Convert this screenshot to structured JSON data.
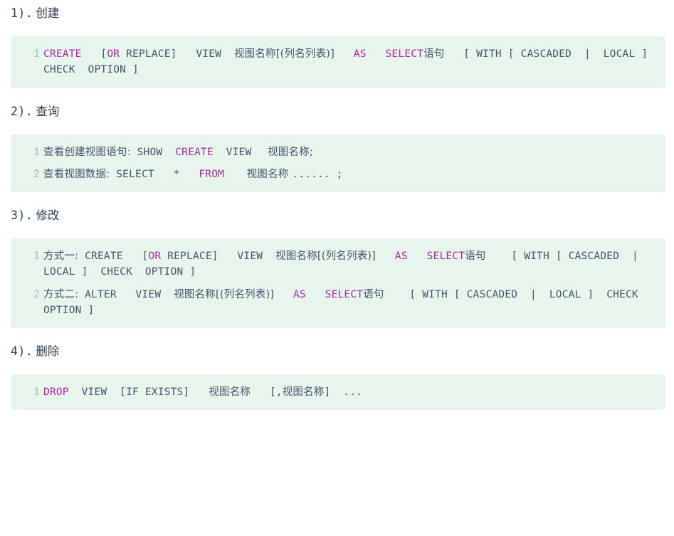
{
  "page": {
    "background": "#ffffff",
    "code_background": "#e7f5ed",
    "keyword_color": "#a62aa0",
    "code_text_color": "#44546a",
    "line_number_color": "#a9bcb0",
    "heading_color": "#2e3d50"
  },
  "sections": [
    {
      "num": "1).",
      "title": "创建",
      "lines": [
        {
          "no": "1",
          "tokens": [
            {
              "t": "CREATE",
              "k": true
            },
            {
              "t": "   ",
              "k": false
            },
            {
              "t": "[",
              "k": false
            },
            {
              "t": "OR",
              "k": true
            },
            {
              "t": " REPLACE]",
              "k": false
            },
            {
              "t": "   ",
              "k": false
            },
            {
              "t": "VIEW",
              "k": false
            },
            {
              "t": "  ",
              "k": false
            },
            {
              "t": "视图名称[(列名列表)]",
              "k": false,
              "cn": true
            },
            {
              "t": "   ",
              "k": false
            },
            {
              "t": "AS",
              "k": true
            },
            {
              "t": "   ",
              "k": false
            },
            {
              "t": "SELECT",
              "k": true
            },
            {
              "t": "语句",
              "k": false,
              "cn": true
            },
            {
              "t": "   ",
              "k": false
            },
            {
              "t": "[ WITH [ CASCADED  |  LOCAL ]  CHECK  OPTION ]",
              "k": false
            }
          ]
        }
      ]
    },
    {
      "num": "2).",
      "title": "查询",
      "lines": [
        {
          "no": "1",
          "tokens": [
            {
              "t": "查看创建视图语句:",
              "k": false,
              "cn": true
            },
            {
              "t": " SHOW  ",
              "k": false
            },
            {
              "t": "CREATE",
              "k": true
            },
            {
              "t": "  VIEW  ",
              "k": false
            },
            {
              "t": " 视图名称;",
              "k": false,
              "cn": true
            }
          ]
        },
        {
          "no": "2",
          "tokens": [
            {
              "t": "查看视图数据:",
              "k": false,
              "cn": true
            },
            {
              "t": " SELECT   *   ",
              "k": false
            },
            {
              "t": "FROM",
              "k": true
            },
            {
              "t": "   ",
              "k": false
            },
            {
              "t": " 视图名称 ",
              "k": false,
              "cn": true
            },
            {
              "t": "...... ;",
              "k": false
            }
          ]
        }
      ]
    },
    {
      "num": "3).",
      "title": "修改",
      "lines": [
        {
          "no": "1",
          "tokens": [
            {
              "t": "方式一:",
              "k": false,
              "cn": true
            },
            {
              "t": " CREATE   ",
              "k": false
            },
            {
              "t": "[",
              "k": false
            },
            {
              "t": "OR",
              "k": true
            },
            {
              "t": " REPLACE]",
              "k": false
            },
            {
              "t": "   ",
              "k": false
            },
            {
              "t": "VIEW",
              "k": false
            },
            {
              "t": "  ",
              "k": false
            },
            {
              "t": "视图名称[(列名列表)]",
              "k": false,
              "cn": true
            },
            {
              "t": "   ",
              "k": false
            },
            {
              "t": "AS",
              "k": true
            },
            {
              "t": "   ",
              "k": false
            },
            {
              "t": "SELECT",
              "k": true
            },
            {
              "t": "语句",
              "k": false,
              "cn": true
            },
            {
              "t": "    ",
              "k": false
            },
            {
              "t": "[ WITH [ CASCADED  |  LOCAL ]  CHECK  OPTION ]",
              "k": false
            }
          ]
        },
        {
          "no": "2",
          "tokens": [
            {
              "t": "方式二:",
              "k": false,
              "cn": true
            },
            {
              "t": " ALTER   VIEW  ",
              "k": false
            },
            {
              "t": "视图名称[(列名列表)]",
              "k": false,
              "cn": true
            },
            {
              "t": "   ",
              "k": false
            },
            {
              "t": "AS",
              "k": true
            },
            {
              "t": "   ",
              "k": false
            },
            {
              "t": "SELECT",
              "k": true
            },
            {
              "t": "语句",
              "k": false,
              "cn": true
            },
            {
              "t": "    ",
              "k": false
            },
            {
              "t": "[ WITH [ CASCADED  |  LOCAL ]  CHECK  OPTION ]",
              "k": false
            }
          ]
        }
      ]
    },
    {
      "num": "4).",
      "title": "删除",
      "lines": [
        {
          "no": "1",
          "tokens": [
            {
              "t": "DROP",
              "k": true
            },
            {
              "t": "  VIEW  [IF EXISTS]   ",
              "k": false
            },
            {
              "t": "视图名称",
              "k": false,
              "cn": true
            },
            {
              "t": "   ",
              "k": false
            },
            {
              "t": "[,",
              "k": false
            },
            {
              "t": "视图名称",
              "k": false,
              "cn": true
            },
            {
              "t": "]",
              "k": false
            },
            {
              "t": "  ...",
              "k": false
            }
          ]
        }
      ]
    }
  ]
}
